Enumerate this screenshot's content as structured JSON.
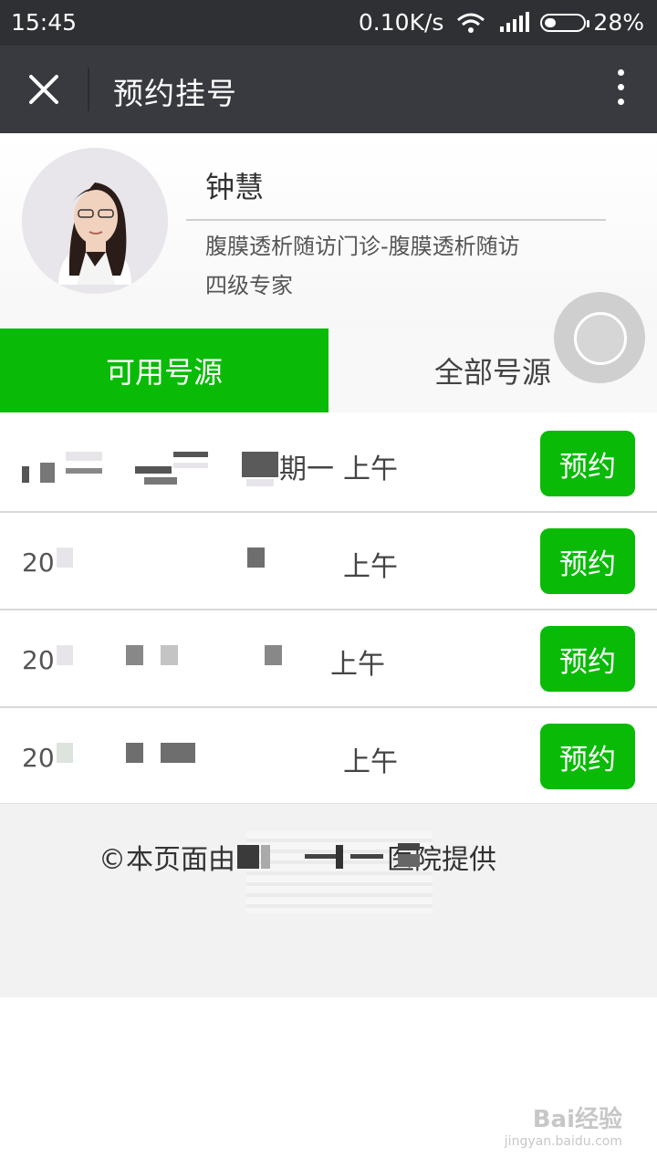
{
  "status_bar": {
    "time": "15:45",
    "net_speed": "0.10K/s",
    "battery": "28%",
    "icons": [
      "wifi-icon",
      "signal-icon",
      "battery-icon"
    ]
  },
  "navbar": {
    "title": "预约挂号",
    "icons": [
      "close-icon",
      "more-icon"
    ]
  },
  "doctor": {
    "name": "钟慧",
    "department": "腹膜透析随访门诊-腹膜透析随访",
    "level": "四级专家"
  },
  "tabs": {
    "available": "可用号源",
    "all": "全部号源"
  },
  "slots": [
    {
      "date": "",
      "weekday": "期一",
      "period": "上午",
      "action": "预约"
    },
    {
      "date": "20",
      "weekday": "",
      "period": "上午",
      "action": "预约"
    },
    {
      "date": "20",
      "weekday": "",
      "period": "上午",
      "action": "预约"
    },
    {
      "date": "20",
      "weekday": "",
      "period": "上午",
      "action": "预约"
    }
  ],
  "footer": {
    "prefix": "©本页面由",
    "suffix": "医院提供"
  },
  "watermark": {
    "brand": "Bai经验",
    "url": "jingyan.baidu.com"
  },
  "colors": {
    "accent": "#09bb07",
    "navbar": "#393a3f",
    "statusbar": "#2f3033"
  }
}
